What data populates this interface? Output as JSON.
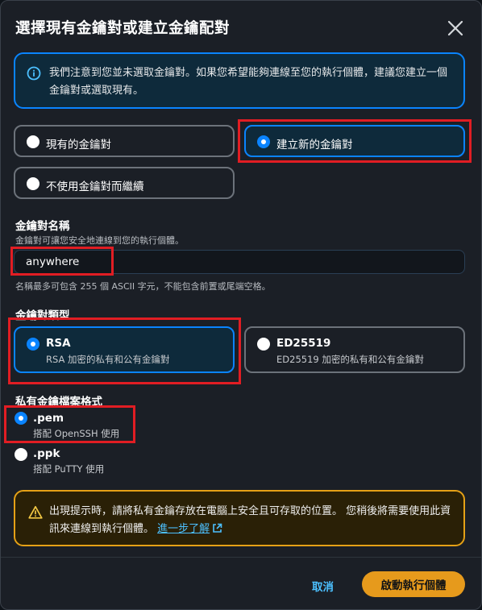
{
  "modal": {
    "title": "選擇現有金鑰對或建立金鑰配對",
    "close_icon": "close-icon"
  },
  "info": {
    "icon": "info-icon",
    "text": "我們注意到您並未選取金鑰對。如果您希望能夠連線至您的執行個體，建議您建立一個金鑰對或選取現有。"
  },
  "key_pair_choice": {
    "existing": "現有的金鑰對",
    "create_new": "建立新的金鑰對",
    "none": "不使用金鑰對而繼續",
    "selected": "create_new"
  },
  "key_name": {
    "label": "金鑰對名稱",
    "description": "金鑰對可讓您安全地連線到您的執行個體。",
    "value": "anywhere",
    "constraint": "名稱最多可包含 255 個 ASCII 字元，不能包含前置或尾端空格。"
  },
  "key_type": {
    "label": "金鑰對類型",
    "options": [
      {
        "name": "RSA",
        "description": "RSA 加密的私有和公有金鑰對",
        "selected": true
      },
      {
        "name": "ED25519",
        "description": "ED25519 加密的私有和公有金鑰對",
        "selected": false
      }
    ]
  },
  "file_format": {
    "label": "私有金鑰檔案格式",
    "options": [
      {
        "name": ".pem",
        "description": "搭配 OpenSSH 使用",
        "selected": true
      },
      {
        "name": ".ppk",
        "description": "搭配 PuTTY 使用",
        "selected": false
      }
    ]
  },
  "warning": {
    "icon": "warning-icon",
    "text": "出現提示時，請將私有金鑰存放在電腦上安全且可存取的位置。 您稍後將需要使用此資訊來連線到執行個體。",
    "link": "進一步了解",
    "link_icon": "external-link-icon"
  },
  "footer": {
    "cancel": "取消",
    "launch": "啟動執行個體"
  },
  "colors": {
    "accent_blue": "#0a84ff",
    "highlight_red": "#e11d23",
    "primary_orange": "#e69a1c",
    "warning_border": "#e5a116"
  }
}
